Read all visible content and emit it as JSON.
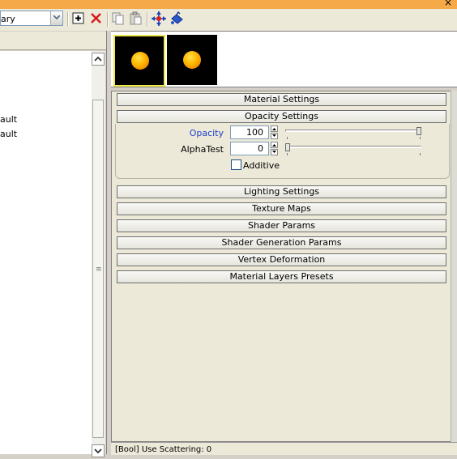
{
  "toolbar": {
    "library_select_value": "ary",
    "buttons": [
      "add-material",
      "delete-material",
      "copy",
      "paste",
      "pick-material",
      "assign-material"
    ]
  },
  "left_panel": {
    "items": [
      "ault",
      "ault"
    ]
  },
  "preview": {
    "thumbnails": [
      "material-preview-1",
      "material-preview-2"
    ]
  },
  "rollups": {
    "material_settings": "Material Settings",
    "opacity_settings": "Opacity Settings",
    "lighting_settings": "Lighting Settings",
    "texture_maps": "Texture Maps",
    "shader_params": "Shader Params",
    "shader_generation_params": "Shader Generation Params",
    "vertex_deformation": "Vertex Deformation",
    "material_layers_presets": "Material Layers Presets"
  },
  "opacity": {
    "opacity_label": "Opacity",
    "opacity_value": "100",
    "opacity_fraction": 1.0,
    "alphatest_label": "AlphaTest",
    "alphatest_value": "0",
    "alphatest_fraction": 0.0,
    "additive_label": "Additive",
    "additive_checked": false
  },
  "status": {
    "text": "[Bool] Use Scattering: 0"
  },
  "colors": {
    "title_strip": "#f5a948",
    "selected_thumb_border": "#f0e94a",
    "highlight_label": "#1f3ecb"
  }
}
